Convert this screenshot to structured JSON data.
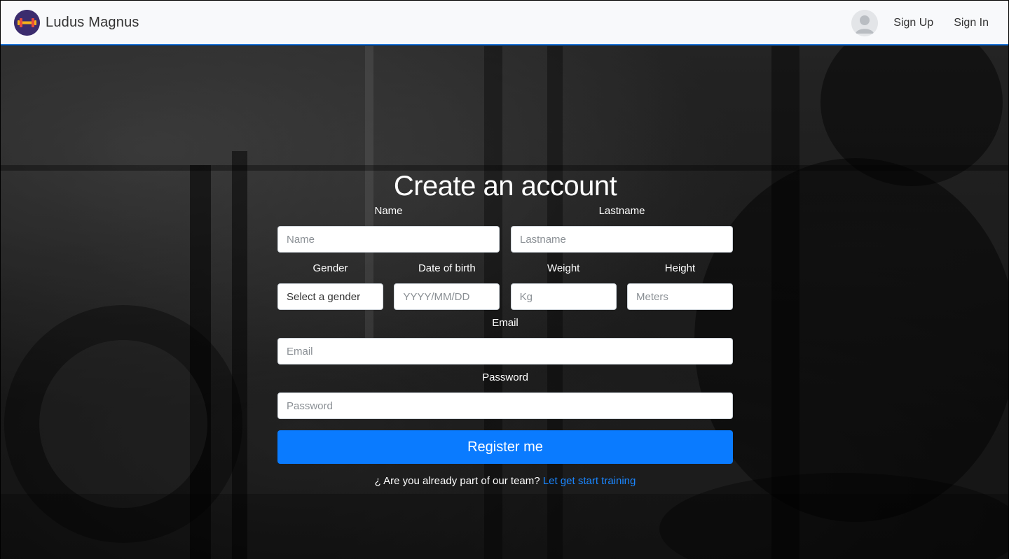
{
  "brand": {
    "name": "Ludus Magnus"
  },
  "nav": {
    "signup": "Sign Up",
    "signin": "Sign In"
  },
  "form": {
    "title": "Create an account",
    "name": {
      "label": "Name",
      "placeholder": "Name"
    },
    "lastname": {
      "label": "Lastname",
      "placeholder": "Lastname"
    },
    "gender": {
      "label": "Gender",
      "value": "Select a gender"
    },
    "dob": {
      "label": "Date of birth",
      "placeholder": "YYYY/MM/DD"
    },
    "weight": {
      "label": "Weight",
      "placeholder": "Kg"
    },
    "height": {
      "label": "Height",
      "placeholder": "Meters"
    },
    "email": {
      "label": "Email",
      "placeholder": "Email"
    },
    "password": {
      "label": "Password",
      "placeholder": "Password"
    },
    "submit": "Register me",
    "footer_text": "¿ Are you already part of our team?",
    "footer_link": "Let get start training"
  },
  "icons": {
    "logo": "dumbbell-icon",
    "avatar": "user-avatar-icon"
  },
  "colors": {
    "accent": "#0a7bff",
    "link": "#1a86ff",
    "nav_border": "#1d74d8"
  }
}
